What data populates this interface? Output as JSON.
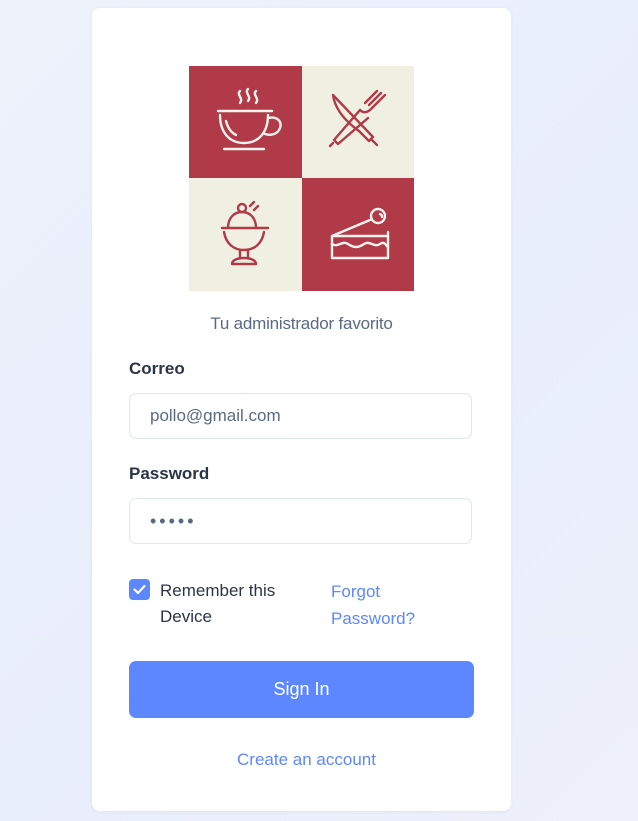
{
  "brand": {
    "tagline": "Tu administrador favorito",
    "logo_icons": [
      "coffee-cup-icon",
      "fork-knife-icon",
      "ice-cream-cup-icon",
      "cake-slice-icon"
    ],
    "logo_colors": {
      "red": "#b03a48",
      "cream": "#f0f0e2"
    }
  },
  "form": {
    "email_label": "Correo",
    "email_value": "pollo@gmail.com",
    "password_label": "Password",
    "password_value": "•••••",
    "remember_checked": true,
    "remember_label": "Remember this Device",
    "forgot_label": "Forgot Password?",
    "signin_label": "Sign In",
    "create_account_label": "Create an account"
  },
  "colors": {
    "accent": "#5d87ff",
    "text": "#2a3547",
    "muted": "#5a6a85",
    "background": "#eef2fb"
  }
}
